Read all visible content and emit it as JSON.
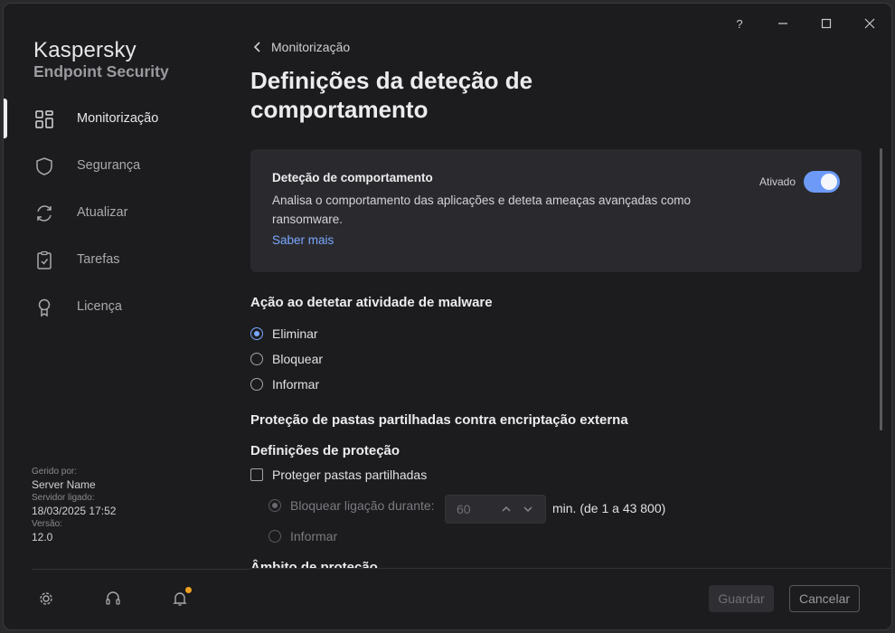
{
  "window": {
    "help_label": "?"
  },
  "brand": {
    "name": "Kaspersky",
    "product": "Endpoint Security"
  },
  "sidebar": {
    "items": [
      {
        "label": "Monitorização",
        "icon": "dashboard-icon",
        "active": true
      },
      {
        "label": "Segurança",
        "icon": "shield-icon",
        "active": false
      },
      {
        "label": "Atualizar",
        "icon": "refresh-icon",
        "active": false
      },
      {
        "label": "Tarefas",
        "icon": "clipboard-icon",
        "active": false
      },
      {
        "label": "Licença",
        "icon": "award-icon",
        "active": false
      }
    ],
    "meta": {
      "managed_by_label": "Gerido por:",
      "managed_by_value": "Server Name",
      "server_connected_label": "Servidor ligado:",
      "server_connected_value": "18/03/2025 17:52",
      "version_label": "Versão:",
      "version_value": "12.0"
    },
    "bottom_icons": [
      "settings-icon",
      "support-icon",
      "notifications-icon"
    ]
  },
  "main": {
    "back_label": "Monitorização",
    "title": "Definições da deteção de comportamento",
    "card": {
      "title": "Deteção de comportamento",
      "description": "Analisa o comportamento das aplicações e deteta ameaças avançadas como ransomware.",
      "learn_more": "Saber mais",
      "toggle_label": "Ativado",
      "toggle_on": true
    },
    "malware_action": {
      "heading": "Ação ao detetar atividade de malware",
      "options": [
        {
          "label": "Eliminar",
          "selected": true
        },
        {
          "label": "Bloquear",
          "selected": false
        },
        {
          "label": "Informar",
          "selected": false
        }
      ]
    },
    "shared_folders": {
      "heading": "Proteção de pastas partilhadas contra encriptação externa",
      "subheading": "Definições de proteção",
      "protect_checkbox_label": "Proteger pastas partilhadas",
      "protect_checked": false,
      "block_option_label": "Bloquear ligação durante:",
      "block_minutes": "60",
      "block_unit": "min. (de 1 a 43 800)",
      "inform_option_label": "Informar"
    },
    "scope_heading": "Âmbito de proteção"
  },
  "footer": {
    "save_label": "Guardar",
    "cancel_label": "Cancelar"
  },
  "colors": {
    "accent": "#7aa7ff",
    "toggle_on": "#6d9af7",
    "notification_dot": "#f0a020",
    "background": "#1c1c1e",
    "card": "#2a2a2e"
  }
}
